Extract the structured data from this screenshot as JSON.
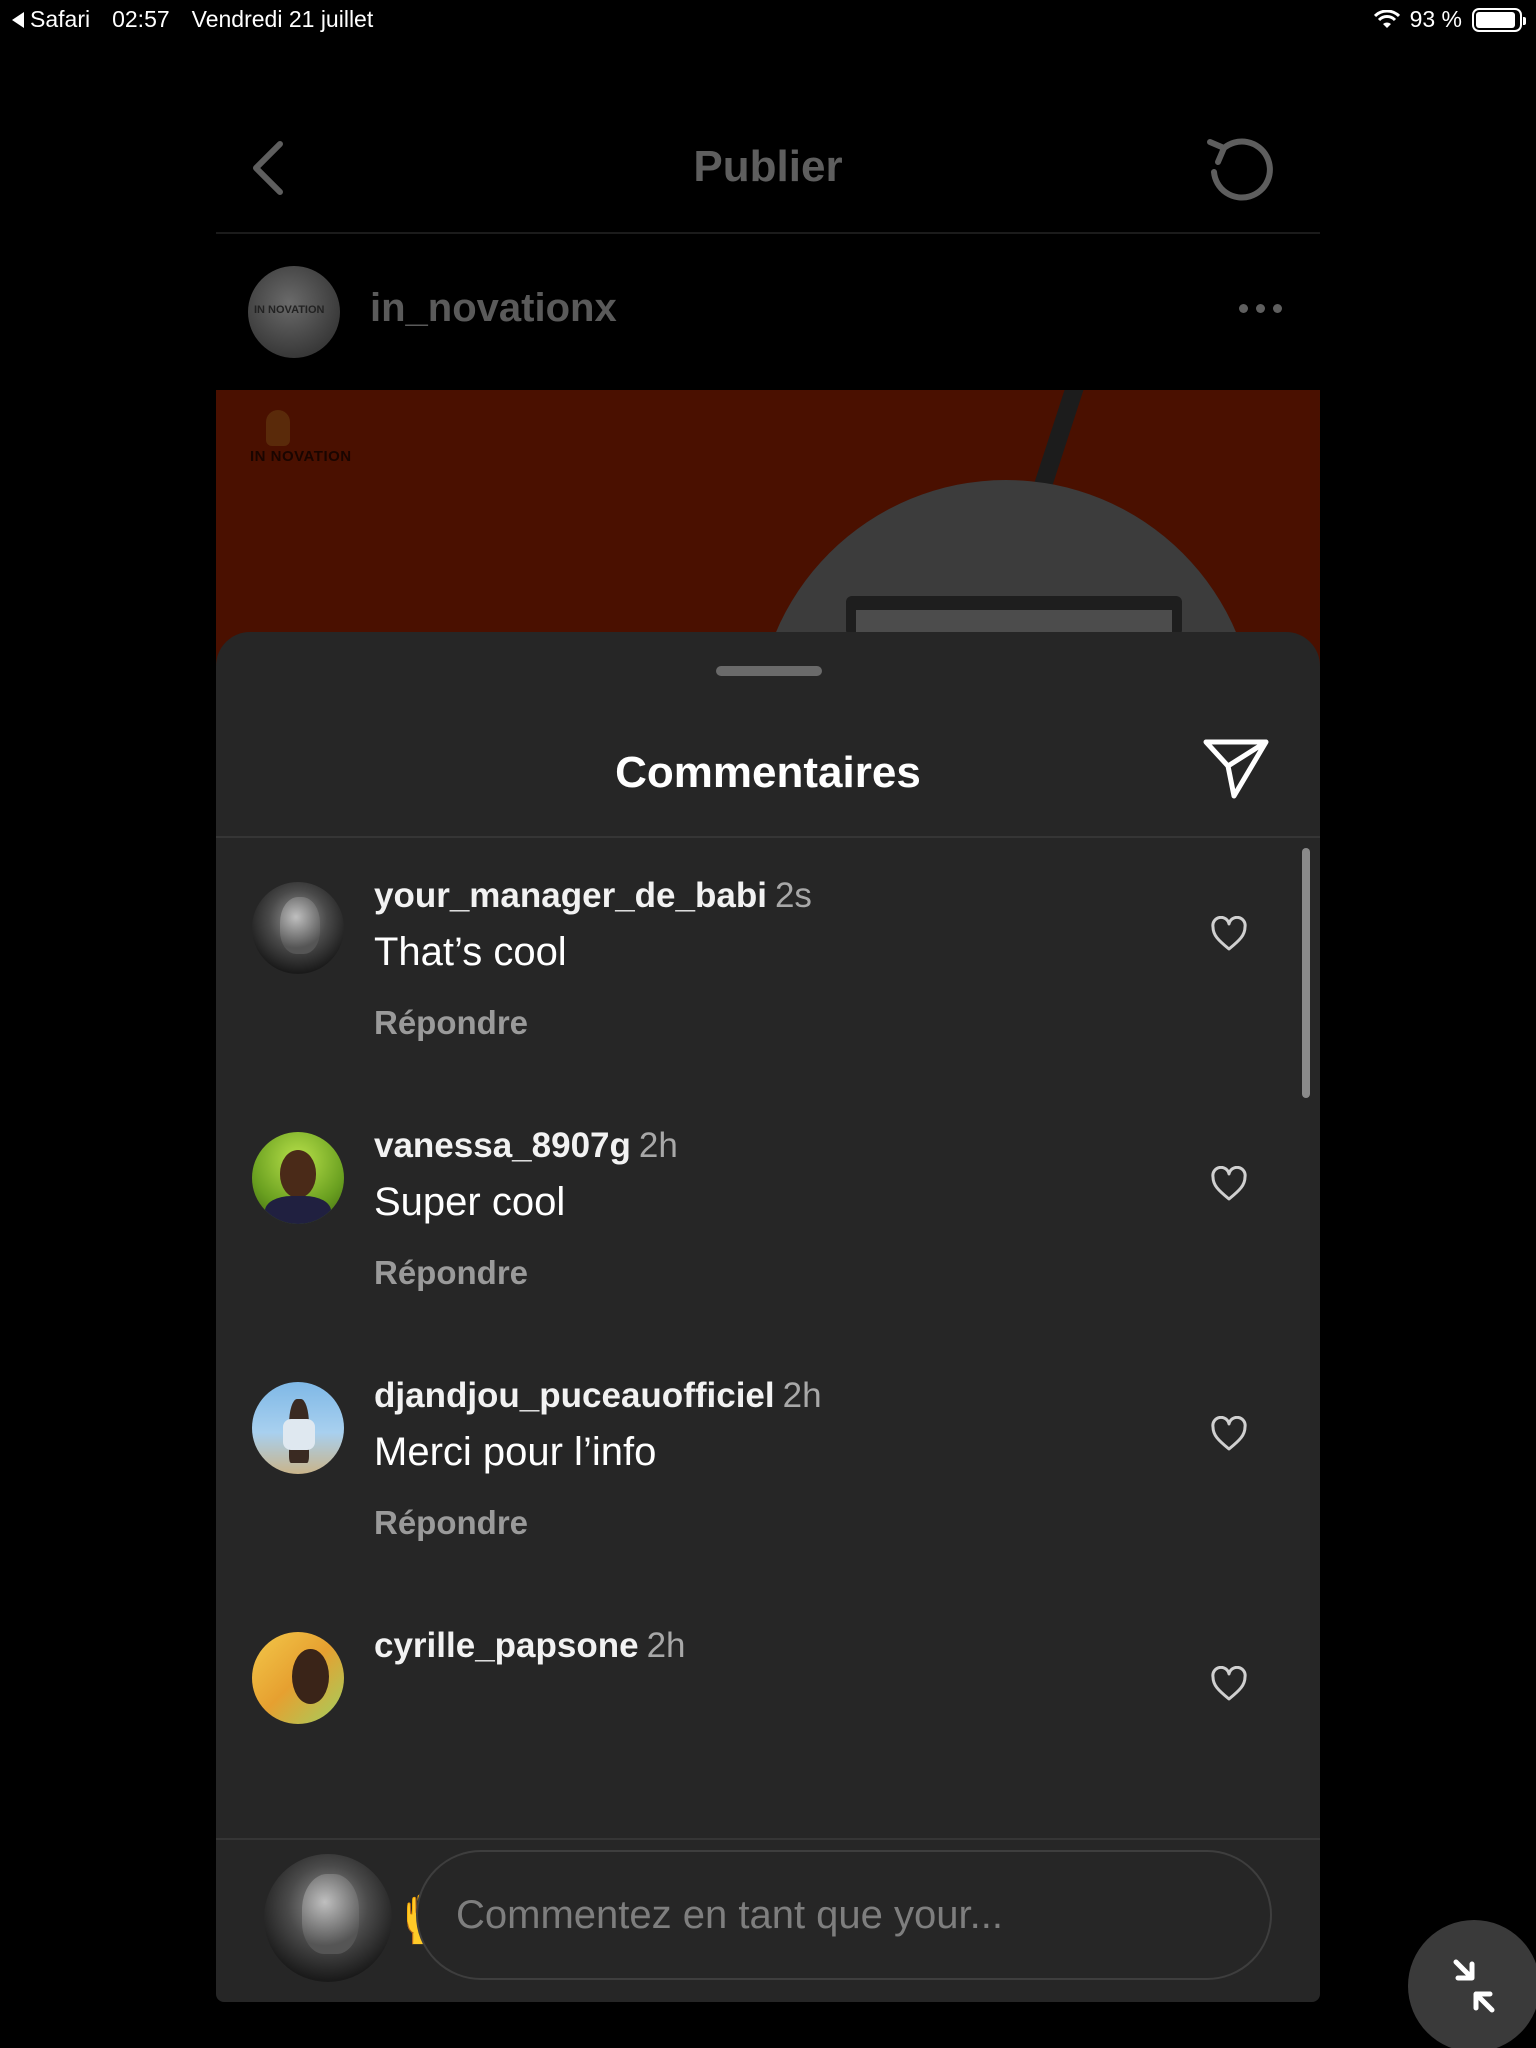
{
  "status_bar": {
    "back_app": "Safari",
    "time": "02:57",
    "date": "Vendredi 21 juillet",
    "battery": "93 %"
  },
  "page": {
    "title": "Publier",
    "username": "in_novationx",
    "logo_text": "IN NOVATION"
  },
  "sheet": {
    "title": "Commentaires"
  },
  "comments": [
    {
      "username": "your_manager_de_babi",
      "time": "2s",
      "text": "That’s cool",
      "reply": "Répondre"
    },
    {
      "username": "vanessa_8907g",
      "time": "2h",
      "text": "Super cool",
      "reply": "Répondre"
    },
    {
      "username": "djandjou_puceauofficiel",
      "time": "2h",
      "text": "Merci pour l’info",
      "reply": "Répondre"
    },
    {
      "username": "cyrille_papsone",
      "time": "2h",
      "text": "",
      "reply": ""
    }
  ],
  "emojis": [
    "❤️",
    "🙌",
    "🔥",
    "👏",
    "😢",
    "😍",
    "😮",
    "😂"
  ],
  "composer": {
    "placeholder": "Commentez en tant que your..."
  },
  "icons": {
    "back": "chevron-left-icon",
    "refresh": "refresh-icon",
    "more": "more-horizontal-icon",
    "share": "send-icon",
    "like": "heart-icon",
    "minimize": "minimize-icon"
  },
  "colors": {
    "sheet_bg": "#262626",
    "post_bg": "#4a1000",
    "muted_text": "#9a9a9a"
  }
}
